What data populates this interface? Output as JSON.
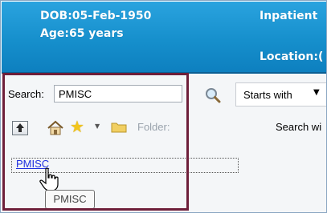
{
  "banner": {
    "dob": "DOB:05-Feb-1950",
    "age": "Age:65 years",
    "inpatient": "Inpatient",
    "location": "Location:("
  },
  "search": {
    "label": "Search:",
    "value": "PMISC",
    "mode": "Starts with",
    "within_label": "Search wi"
  },
  "toolbar": {
    "icons": [
      "up-folder-icon",
      "home-icon",
      "star-icon",
      "folder-icon"
    ],
    "folder_label": "Folder:"
  },
  "results": {
    "items": [
      {
        "label": "PMISC"
      }
    ],
    "tooltip": "PMISC"
  },
  "colors": {
    "banner": "#168fcc",
    "highlight_border": "#6e1f3a",
    "link": "#1f2fe0"
  }
}
